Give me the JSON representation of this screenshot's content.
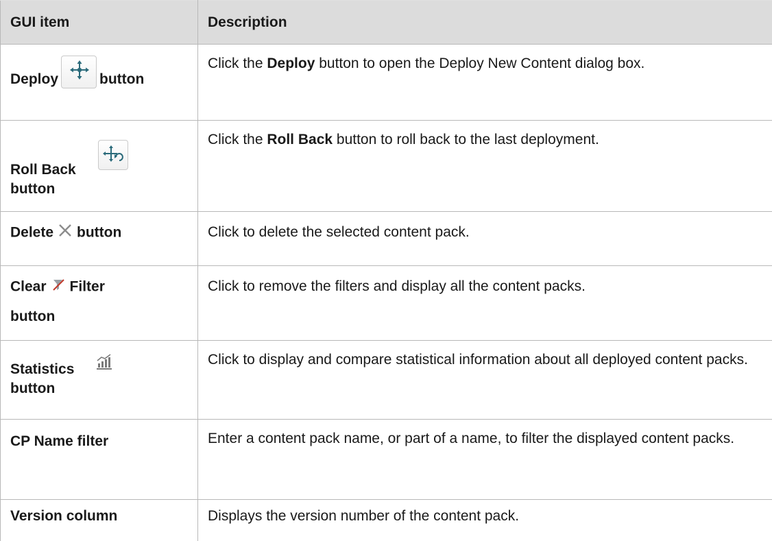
{
  "table": {
    "headers": {
      "gui_item": "GUI item",
      "description": "Description"
    },
    "rows": {
      "deploy": {
        "label": "Deploy",
        "suffix": "button",
        "icon": "deploy-icon",
        "desc_pre": "Click the ",
        "desc_bold": "Deploy",
        "desc_post": " button to open the Deploy New Content dialog box."
      },
      "rollback": {
        "label": "Roll Back",
        "suffix": "button",
        "icon": "rollback-icon",
        "desc_pre": "Click the ",
        "desc_bold": "Roll Back",
        "desc_post": " button to roll back to the last deployment."
      },
      "delete": {
        "label": "Delete",
        "suffix": "button",
        "icon": "close-icon",
        "desc": "Click to delete the selected content pack."
      },
      "clear_filter": {
        "label": "Clear",
        "label2": "Filter",
        "suffix": "button",
        "icon": "clear-filter-icon",
        "desc": "Click to remove the filters and display all the content packs."
      },
      "statistics": {
        "label": "Statistics",
        "suffix": "button",
        "icon": "statistics-icon",
        "desc": "Click to display and compare statistical information about all deployed content packs."
      },
      "cp_name": {
        "label": "CP Name filter",
        "desc": "Enter a content pack name, or part of a name, to filter the displayed content packs."
      },
      "version": {
        "label": "Version column",
        "desc": "Displays the version number of the content pack."
      }
    }
  },
  "colors": {
    "header_bg": "#dcdcdc",
    "border": "#b8b8b8",
    "text": "#1a1a1a"
  }
}
